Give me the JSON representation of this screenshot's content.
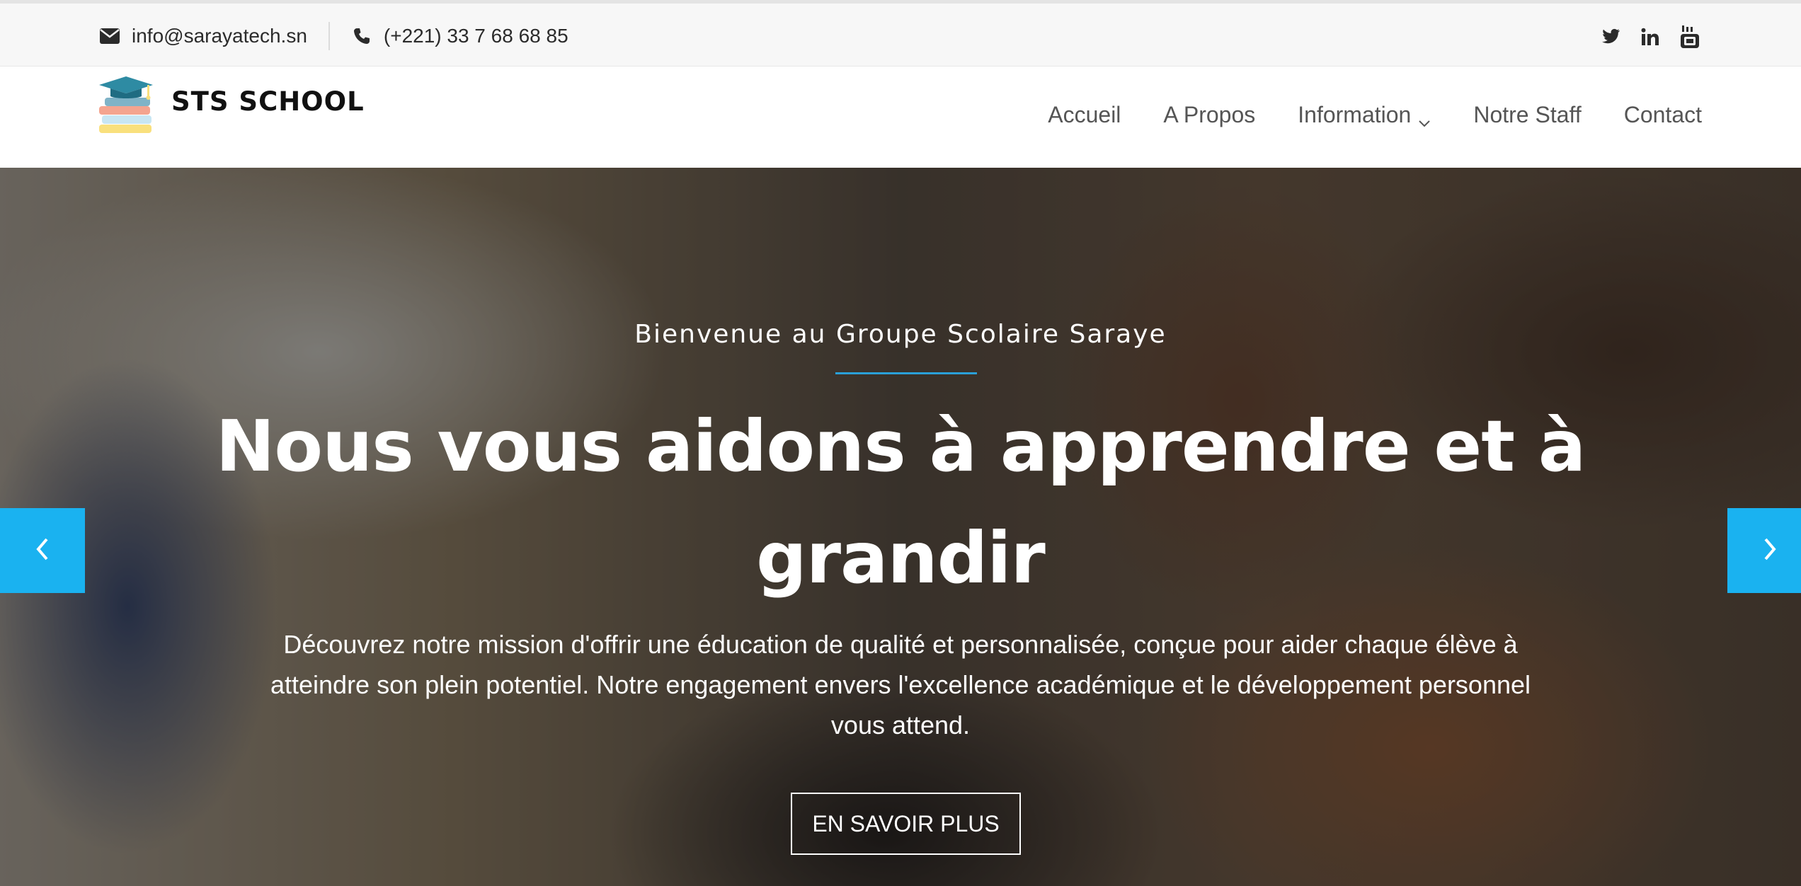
{
  "topbar": {
    "email": "info@sarayatech.sn",
    "phone": "(+221) 33 7 68 68 85",
    "social": [
      "twitter-icon",
      "linkedin-icon",
      "youtube-icon"
    ]
  },
  "brand": {
    "name": "STS SCHOOL"
  },
  "nav": {
    "home": "Accueil",
    "about": "A Propos",
    "info": "Information",
    "staff": "Notre Staff",
    "contact": "Contact"
  },
  "hero": {
    "welcome": "Bienvenue au Groupe Scolaire Saraye",
    "headline": "Nous vous aidons à apprendre et à grandir",
    "description": "Découvrez notre mission d'offrir une éducation de qualité et personnalisée, conçue pour aider chaque élève à atteindre son plein potentiel. Notre engagement envers l'excellence académique et le développement personnel vous attend.",
    "cta": "EN SAVOIR PLUS"
  },
  "colors": {
    "accent": "#1ab2f0",
    "welcome_rule": "#2aa0d8"
  }
}
